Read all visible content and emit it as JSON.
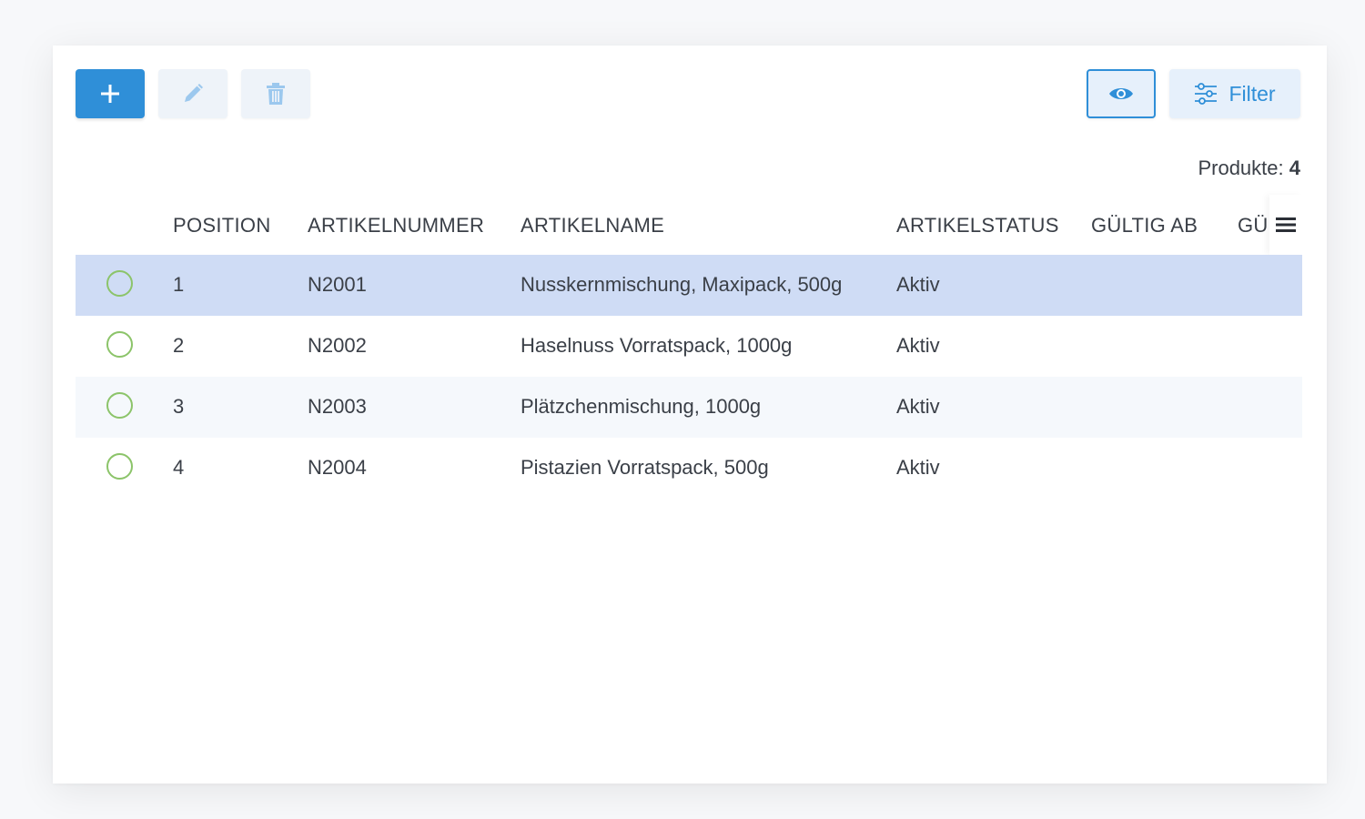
{
  "toolbar": {
    "add_label": "+",
    "filter_label": "Filter"
  },
  "colors": {
    "primary": "#2f8fd8",
    "selected_row": "#cfdcf5",
    "radio": "#8cc46a"
  },
  "summary": {
    "label": "Produkte:",
    "count": "4"
  },
  "table": {
    "columns": [
      "POSITION",
      "ARTIKELNUMMER",
      "ARTIKELNAME",
      "ARTIKELSTATUS",
      "GÜLTIG AB",
      "GÜ"
    ],
    "rows": [
      {
        "position": "1",
        "artikelnummer": "N2001",
        "artikelname": "Nusskernmischung, Maxipack, 500g",
        "status": "Aktiv",
        "selected": true
      },
      {
        "position": "2",
        "artikelnummer": "N2002",
        "artikelname": "Haselnuss Vorratspack, 1000g",
        "status": "Aktiv",
        "selected": false
      },
      {
        "position": "3",
        "artikelnummer": "N2003",
        "artikelname": "Plätzchenmischung, 1000g",
        "status": "Aktiv",
        "selected": false
      },
      {
        "position": "4",
        "artikelnummer": "N2004",
        "artikelname": "Pistazien Vorratspack, 500g",
        "status": "Aktiv",
        "selected": false
      }
    ]
  },
  "icons": {
    "add": "plus-icon",
    "edit": "pencil-icon",
    "delete": "trash-icon",
    "view": "eye-icon",
    "filter": "sliders-icon",
    "column_menu": "hamburger-menu-icon"
  }
}
